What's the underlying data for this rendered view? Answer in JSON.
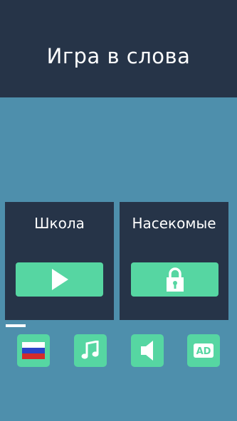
{
  "header": {
    "title": "Игра в слова"
  },
  "categories": [
    {
      "title": "Школа",
      "state": "play",
      "icon": "play-icon"
    },
    {
      "title": "Насекомые",
      "state": "locked",
      "icon": "lock-icon"
    }
  ],
  "bottom_bar": [
    {
      "name": "language",
      "icon": "russian-flag-icon"
    },
    {
      "name": "music",
      "icon": "music-note-icon"
    },
    {
      "name": "sound",
      "icon": "speaker-icon"
    },
    {
      "name": "ads",
      "icon": "ad-icon",
      "label": "AD"
    }
  ],
  "colors": {
    "background": "#4e8fac",
    "panel": "#263448",
    "accent": "#56d6a2",
    "flag_white": "#ffffff",
    "flag_blue": "#2b44c8",
    "flag_red": "#d32b2b"
  }
}
